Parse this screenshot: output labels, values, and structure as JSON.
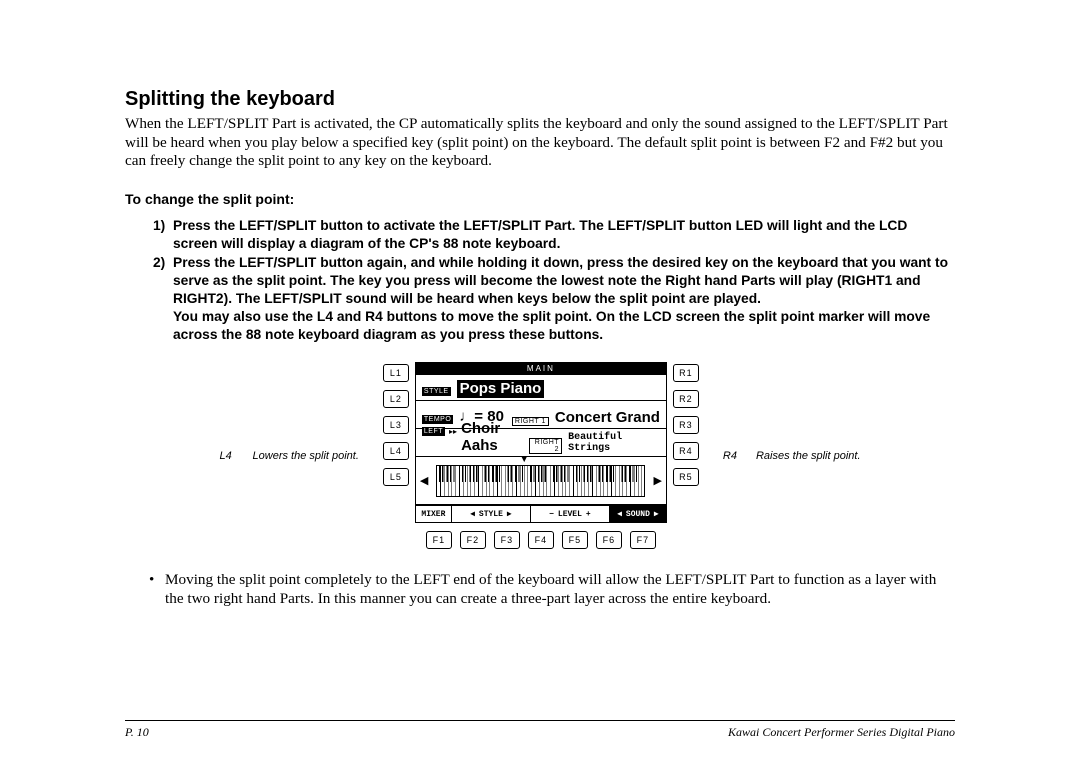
{
  "section": {
    "title": "Splitting the keyboard",
    "intro": "When the LEFT/SPLIT Part is activated, the CP automatically splits the keyboard and only the sound assigned to the LEFT/SPLIT Part will be heard when you play below a specified key (split point) on the keyboard.  The default split point is between F2 and F#2 but you can freely change the split point to any key on the keyboard."
  },
  "procedure": {
    "heading": "To change the split point:",
    "steps": [
      {
        "n": "1)",
        "text": "Press the LEFT/SPLIT button to activate the LEFT/SPLIT Part.  The LEFT/SPLIT button LED will light and the LCD screen will display a diagram of the CP's 88 note keyboard."
      },
      {
        "n": "2)",
        "text": "Press the LEFT/SPLIT button again, and while holding it down, press the desired key on the keyboard that you want to serve as the split point.  The key you press will become the lowest note the Right hand Parts will play (RIGHT1 and RIGHT2).  The LEFT/SPLIT sound will be heard when keys below the split point are played.\nYou may also use the L4 and R4 buttons to move the split point.  On the LCD screen the split point marker will move across the 88 note keyboard diagram as you press these buttons."
      }
    ]
  },
  "figure": {
    "left_caption": {
      "btn": "L4",
      "text": "Lowers the split point."
    },
    "right_caption": {
      "btn": "R4",
      "text": "Raises the split point."
    },
    "L": [
      "L1",
      "L2",
      "L3",
      "L4",
      "L5"
    ],
    "R": [
      "R1",
      "R2",
      "R3",
      "R4",
      "R5"
    ],
    "F": [
      "F1",
      "F2",
      "F3",
      "F4",
      "F5",
      "F6",
      "F7"
    ],
    "lcd": {
      "top": "MAIN",
      "row1": {
        "tag": "STYLE",
        "name": "Pops Piano"
      },
      "row2": {
        "tempo_tag": "TEMPO",
        "tempo": "80",
        "right_tag1": "RIGHT 1",
        "right1": "Concert Grand"
      },
      "row3": {
        "left_tag": "LEFT",
        "play": "▸▸",
        "left_name": "Choir Aahs",
        "right_tag2": "RIGHT 2",
        "right2": "Beautiful Strings"
      },
      "arrows": {
        "l": "◀",
        "r": "▶",
        "marker": "▼"
      },
      "bottom": {
        "mixer": "MIXER",
        "style": "STYLE",
        "level": "LEVEL",
        "sound": "SOUND"
      }
    }
  },
  "note": {
    "text": "Moving the split point completely to the LEFT end of the keyboard will allow the LEFT/SPLIT Part to function as a layer with the two right hand Parts.  In this manner you can create a three-part layer across the entire keyboard."
  },
  "footer": {
    "left": "P. 10",
    "right": "Kawai Concert Performer Series Digital Piano"
  }
}
